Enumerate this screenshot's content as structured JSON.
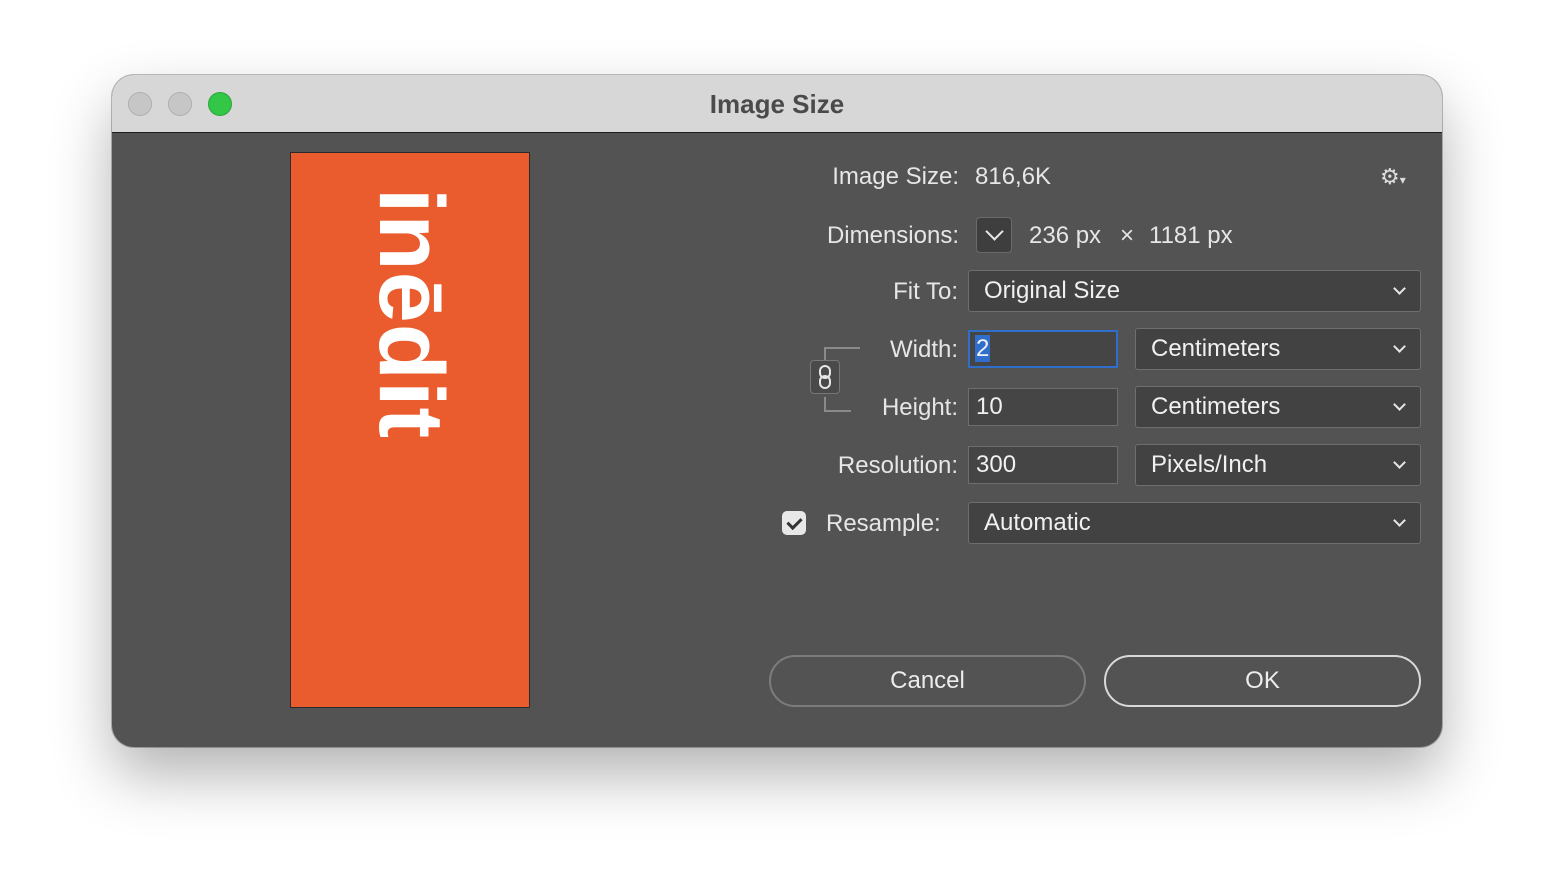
{
  "window": {
    "title": "Image Size"
  },
  "preview": {
    "text": "inēdit",
    "bg_color": "#ea5c2d"
  },
  "image_size": {
    "label": "Image Size:",
    "value": "816,6K"
  },
  "dimensions": {
    "label": "Dimensions:",
    "width": "236 px",
    "times": "×",
    "height": "1181 px"
  },
  "fit_to": {
    "label": "Fit To:",
    "value": "Original Size"
  },
  "width": {
    "label": "Width:",
    "value": "2",
    "unit": "Centimeters"
  },
  "height": {
    "label": "Height:",
    "value": "10",
    "unit": "Centimeters"
  },
  "resolution": {
    "label": "Resolution:",
    "value": "300",
    "unit": "Pixels/Inch"
  },
  "resample": {
    "label": "Resample:",
    "checked": true,
    "value": "Automatic"
  },
  "buttons": {
    "cancel": "Cancel",
    "ok": "OK"
  },
  "icons": {
    "gear": "gear-icon",
    "chain": "link-icon"
  }
}
